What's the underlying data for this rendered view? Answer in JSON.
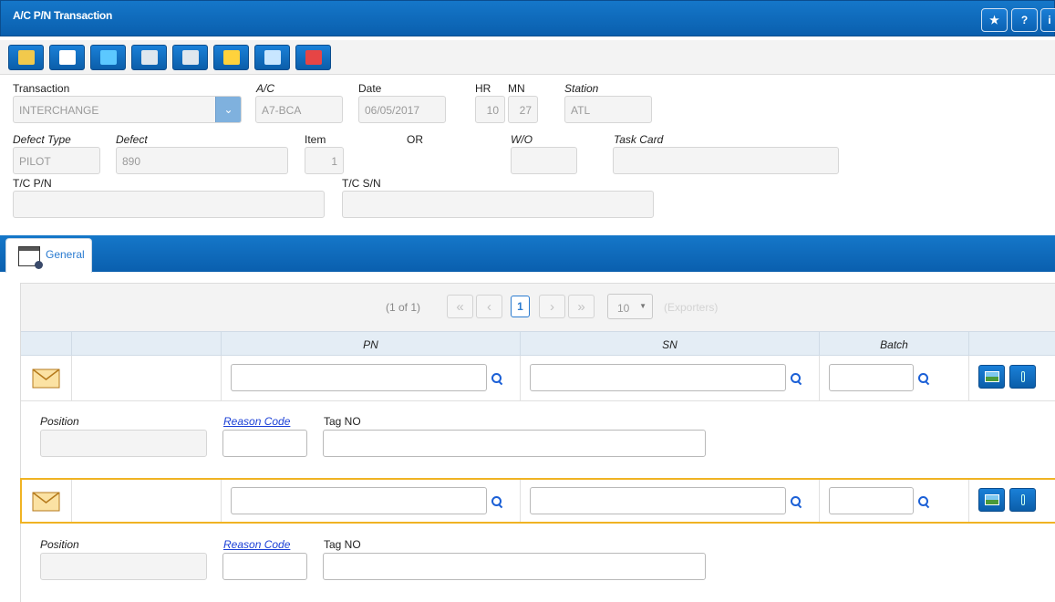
{
  "window": {
    "title": "A/C P/N Transaction"
  },
  "titlebar_buttons": {
    "star": "★",
    "help": "?",
    "info": "i"
  },
  "toolbar": {
    "tools": [
      {
        "name": "new-record-icon",
        "color": "#f2c94c"
      },
      {
        "name": "save-icon",
        "color": "#ffffff"
      },
      {
        "name": "book-icon",
        "color": "#5cc8ff"
      },
      {
        "name": "binoculars-icon",
        "color": "#dfe7ee"
      },
      {
        "name": "binoculars-gear-icon",
        "color": "#dfe7ee"
      },
      {
        "name": "airplane-icon",
        "color": "#ffd23c"
      },
      {
        "name": "user-computer-icon",
        "color": "#c8e6ff"
      },
      {
        "name": "gear-red-icon",
        "color": "#e64545"
      }
    ]
  },
  "form": {
    "transaction_label": "Transaction",
    "transaction_value": "INTERCHANGE",
    "ac_label": "A/C",
    "ac_value": "A7-BCA",
    "date_label": "Date",
    "date_value": "06/05/2017",
    "hr_label": "HR",
    "hr_value": "10",
    "mn_label": "MN",
    "mn_value": "27",
    "station_label": "Station",
    "station_value": "ATL",
    "defect_type_label": "Defect Type",
    "defect_type_value": "PILOT",
    "defect_label": "Defect",
    "defect_value": "890",
    "item_label": "Item",
    "item_value": "1",
    "or_label": "OR",
    "wo_label": "W/O",
    "wo_value": "",
    "task_card_label": "Task Card",
    "task_card_value": "",
    "tc_pn_label": "T/C P/N",
    "tc_pn_value": "",
    "tc_sn_label": "T/C S/N",
    "tc_sn_value": ""
  },
  "tabs": [
    {
      "label": "General"
    }
  ],
  "pager": {
    "summary": "(1 of 1)",
    "current_page": "1",
    "first": "«",
    "prev": "‹",
    "next": "›",
    "last": "»",
    "rows_per_page": "10",
    "exporters": "(Exporters)"
  },
  "table": {
    "columns": [
      "PN",
      "SN",
      "Batch"
    ],
    "rows": [
      {
        "pn": "",
        "sn": "",
        "batch": "",
        "position_label": "Position",
        "reason_code_label": "Reason Code",
        "tag_no_label": "Tag NO",
        "selected": false
      },
      {
        "pn": "",
        "sn": "",
        "batch": "",
        "position_label": "Position",
        "reason_code_label": "Reason Code",
        "tag_no_label": "Tag NO",
        "selected": true
      }
    ]
  },
  "colors": {
    "brand_blue": "#0a5fae",
    "link_blue": "#1a3fd6",
    "selection": "#f0b323"
  }
}
